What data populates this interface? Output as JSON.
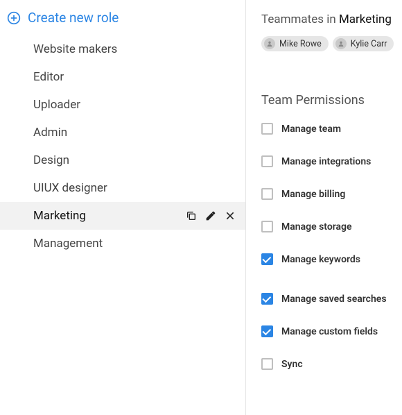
{
  "create_label": "Create new role",
  "roles": [
    {
      "label": "Website makers",
      "selected": false
    },
    {
      "label": "Editor",
      "selected": false
    },
    {
      "label": "Uploader",
      "selected": false
    },
    {
      "label": "Admin",
      "selected": false
    },
    {
      "label": "Design",
      "selected": false
    },
    {
      "label": "UIUX designer",
      "selected": false
    },
    {
      "label": "Marketing",
      "selected": true
    },
    {
      "label": "Management",
      "selected": false
    }
  ],
  "teammates": {
    "prefix": "Teammates in ",
    "role": "Marketing",
    "people": [
      {
        "name": "Mike Rowe"
      },
      {
        "name": "Kylie Carr"
      }
    ]
  },
  "permissions_title": "Team Permissions",
  "permissions": [
    {
      "label": "Manage team",
      "checked": false
    },
    {
      "label": "Manage integrations",
      "checked": false
    },
    {
      "label": "Manage billing",
      "checked": false
    },
    {
      "label": "Manage storage",
      "checked": false
    },
    {
      "label": "Manage keywords",
      "checked": true,
      "gap": true
    },
    {
      "label": "Manage saved searches",
      "checked": true
    },
    {
      "label": "Manage custom fields",
      "checked": true
    },
    {
      "label": "Sync",
      "checked": false
    }
  ]
}
